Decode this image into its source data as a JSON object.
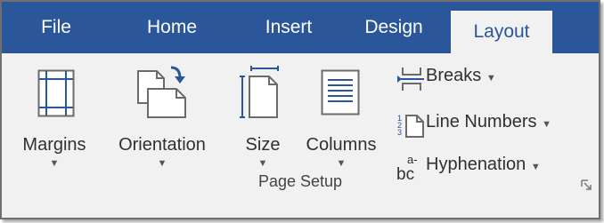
{
  "tabs": {
    "file": "File",
    "home": "Home",
    "insert": "Insert",
    "design": "Design",
    "layout": "Layout"
  },
  "page_setup": {
    "margins": "Margins",
    "orientation": "Orientation",
    "size": "Size",
    "columns": "Columns",
    "breaks": "Breaks",
    "line_numbers": "Line Numbers",
    "hyphenation": "Hyphenation",
    "group_label": "Page Setup"
  },
  "colors": {
    "tab_bar": "#2b579a",
    "ribbon_bg": "#f1f1f1",
    "icon_blue": "#2b579a",
    "icon_gray": "#6b6b6b"
  },
  "icons": {
    "margins": "margins-icon",
    "orientation": "orientation-icon",
    "size": "size-icon",
    "columns": "columns-icon",
    "breaks": "breaks-icon",
    "line_numbers": "line-numbers-icon",
    "hyphenation": "hyphenation-icon",
    "dropdown": "caret-down-icon",
    "dialog_launcher": "dialog-launcher-icon"
  }
}
